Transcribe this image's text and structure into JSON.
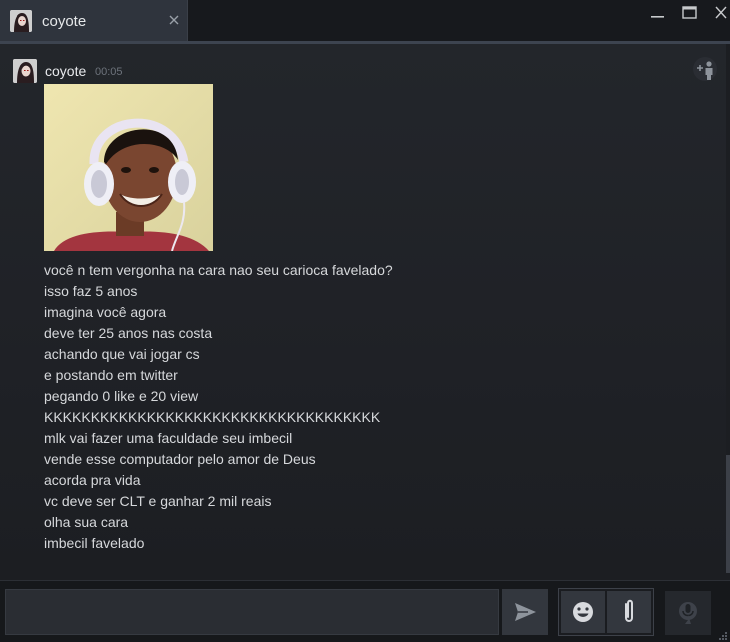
{
  "window": {
    "tab_title": "coyote",
    "tab_close_icon": "close-icon",
    "controls": [
      "minimize-icon",
      "maximize-icon",
      "close-icon"
    ]
  },
  "chat": {
    "add_friend_icon": "add-user-icon",
    "message": {
      "author": "coyote",
      "time": "00:05",
      "image": "webcam-photo-of-person-with-white-headset",
      "lines": [
        "você n tem vergonha na cara nao seu carioca favelado?",
        "isso faz 5 anos",
        "imagina você agora",
        "deve ter 25 anos nas costa",
        "achando que vai jogar cs",
        "e postando em twitter",
        "pegando 0 like e 20 view",
        "KKKKKKKKKKKKKKKKKKKKKKKKKKKKKKKKKKKK",
        "mlk vai fazer uma faculdade seu imbecil",
        "vende esse computador pelo amor de Deus",
        "acorda pra vida",
        "vc deve ser CLT e ganhar 2 mil reais",
        "olha sua cara",
        "imbecil favelado"
      ]
    }
  },
  "composer": {
    "input_value": "",
    "send_icon": "send-icon",
    "emoji_icon": "emoji-icon",
    "attach_icon": "paperclip-icon",
    "voice_icon": "microphone-icon"
  },
  "colors": {
    "background": "#1e2025",
    "tab": "#2f343d",
    "text": "#d6d8db",
    "muted": "#6d737b"
  }
}
